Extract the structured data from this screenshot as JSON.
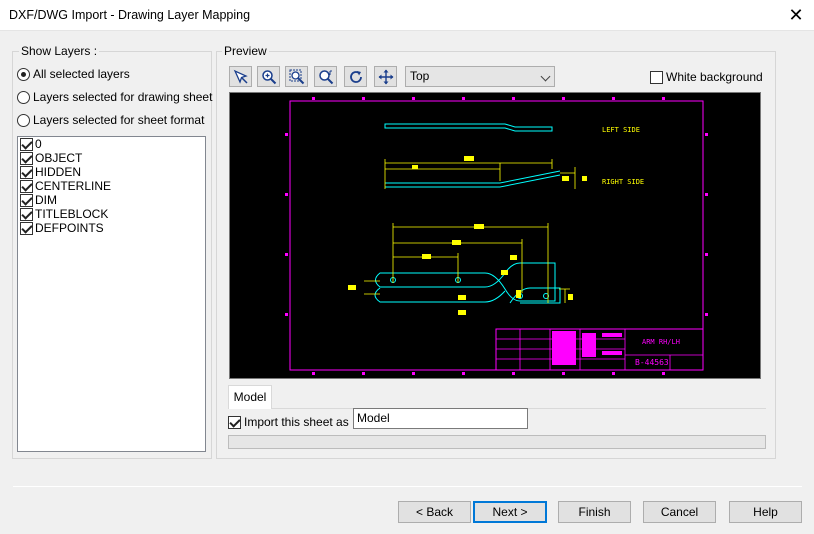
{
  "window": {
    "title": "DXF/DWG Import - Drawing Layer Mapping"
  },
  "show_layers": {
    "label": "Show Layers :",
    "options": [
      {
        "label": "All selected layers",
        "selected": true
      },
      {
        "label": "Layers selected for drawing sheet",
        "selected": false
      },
      {
        "label": "Layers selected for sheet format",
        "selected": false
      }
    ],
    "layers": [
      {
        "label": "0",
        "checked": true
      },
      {
        "label": "OBJECT",
        "checked": true
      },
      {
        "label": "HIDDEN",
        "checked": true
      },
      {
        "label": "CENTERLINE",
        "checked": true
      },
      {
        "label": "DIM",
        "checked": true
      },
      {
        "label": "TITLEBLOCK",
        "checked": true
      },
      {
        "label": "DEFPOINTS",
        "checked": true
      }
    ]
  },
  "preview": {
    "label": "Preview",
    "view_select": {
      "value": "Top"
    },
    "white_background": {
      "label": "White background",
      "checked": false
    },
    "drawing_text": {
      "left_side": "LEFT SIDE",
      "right_side": "RIGHT SIDE",
      "title_block_name": "ARM RH/LH",
      "title_block_number": "B-44563"
    },
    "colors": {
      "background": "#000000",
      "border": "#ff00ff",
      "geometry": "#00ffff",
      "dimension": "#ffff00"
    }
  },
  "sheet": {
    "tab_label": "Model",
    "import_checkbox": {
      "label": "Import this sheet as :",
      "checked": true
    },
    "sheet_name": "Model"
  },
  "buttons": {
    "back": "< Back",
    "next": "Next >",
    "finish": "Finish",
    "cancel": "Cancel",
    "help": "Help"
  }
}
